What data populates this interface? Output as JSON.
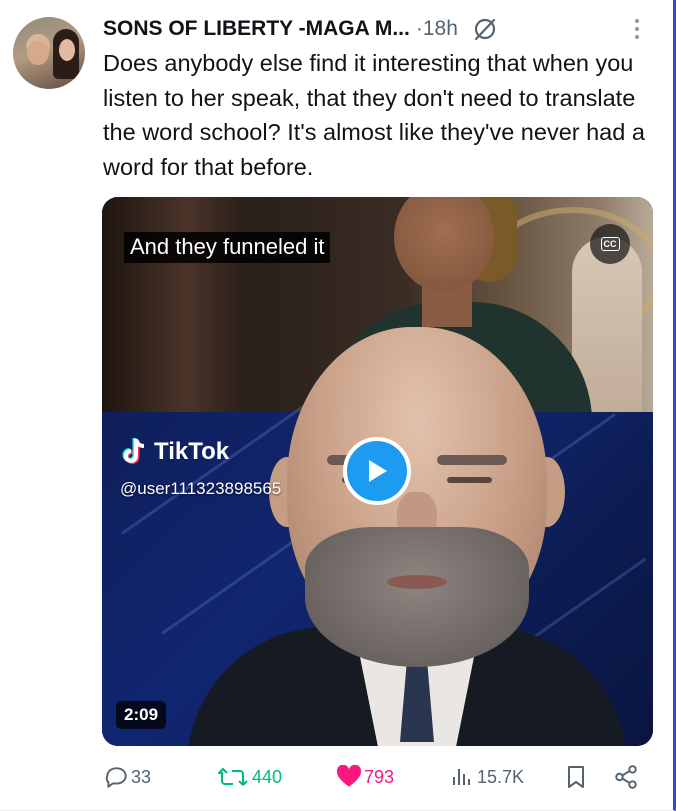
{
  "post": {
    "author": "SONS OF LIBERTY -MAGA M...",
    "separator": "·",
    "time": "18h",
    "text": "Does anybody else find it interesting that when you listen to her speak, that they don't need to translate the word school? It's almost like they've never had a word for that before."
  },
  "media": {
    "caption": "And they funneled it",
    "cc_label": "CC",
    "tiktok_brand": "TikTok",
    "tiktok_user": "@user111323898565",
    "duration": "2:09"
  },
  "actions": {
    "replies": "33",
    "reposts": "440",
    "likes": "793",
    "views": "15.7K"
  },
  "colors": {
    "repost": "#00ba7c",
    "like": "#f91880",
    "play": "#1d9bf0",
    "muted": "#536471"
  },
  "icons": {
    "more": "more-icon",
    "grok": "grok-icon",
    "cc": "closed-captions-icon",
    "play": "play-icon",
    "reply": "reply-icon",
    "repost": "repost-icon",
    "like": "heart-icon",
    "views": "views-icon",
    "bookmark": "bookmark-icon",
    "share": "share-icon"
  }
}
